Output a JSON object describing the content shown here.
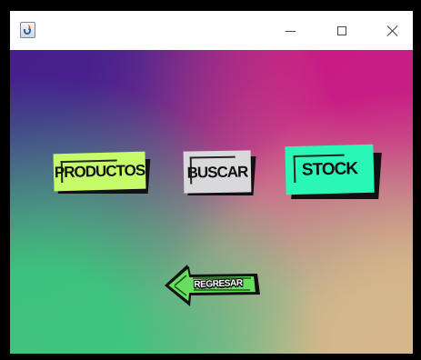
{
  "window": {
    "title": "",
    "controls": {
      "minimize": "—",
      "maximize": "☐",
      "close": "✕"
    }
  },
  "buttons": {
    "productos": "PRODUCTOS",
    "buscar": "BUSCAR",
    "stock": "STOCK",
    "regresar": "REGRESAR"
  },
  "colors": {
    "productos": "#c6fb69",
    "buscar": "#d9d9db",
    "stock": "#2af7b5",
    "regresar": "#66df5f",
    "background_top_left": "#461f8d",
    "background_top_right": "#c81884",
    "background_bottom_left": "#38c87d",
    "background_bottom_right": "#d6b78b"
  },
  "icons": {
    "app": "java-coffee-icon",
    "minimize": "minimize-icon",
    "maximize": "maximize-icon",
    "close": "close-icon",
    "back": "back-arrow-icon"
  }
}
